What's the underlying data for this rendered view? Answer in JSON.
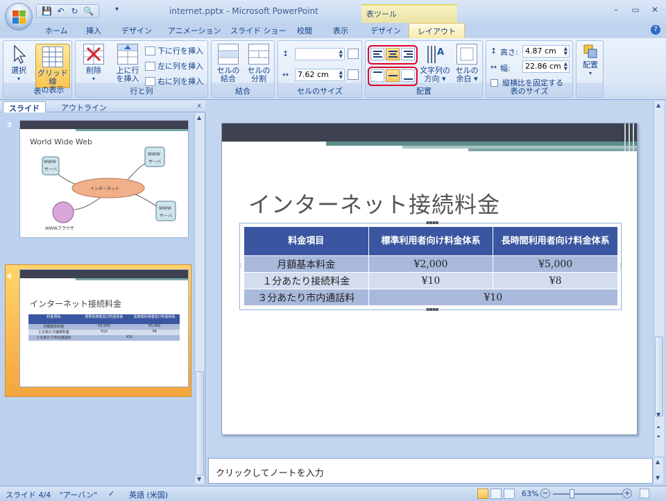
{
  "window": {
    "title": "internet.pptx - Microsoft PowerPoint",
    "contextual_label": "表ツール",
    "minimize": "–",
    "restore": "▭",
    "close": "✕"
  },
  "qat": {
    "save": "💾",
    "undo": "↶",
    "redo": "↻",
    "preview": "🔍",
    "more": "▾"
  },
  "tabs": [
    "ホーム",
    "挿入",
    "デザイン",
    "アニメーション",
    "スライド ショー",
    "校閲",
    "表示",
    "デザイン",
    "レイアウト"
  ],
  "active_tab": "レイアウト",
  "help": "?",
  "ribbon": {
    "groups": {
      "table": "表",
      "rows_cols": "行と列",
      "merge": "結合",
      "cell_size": "セルのサイズ",
      "alignment": "配置",
      "table_size": "表のサイズ",
      "arrange": ""
    },
    "select": {
      "line1": "選択",
      "line2": "▾"
    },
    "gridlines": {
      "line1": "グリッド線",
      "line2": "の表示"
    },
    "delete": {
      "line1": "削除",
      "line2": "▾"
    },
    "insert_above": {
      "line1": "上に行",
      "line2": "を挿入"
    },
    "insert_below": "下に行を挿入",
    "insert_left": "左に列を挿入",
    "insert_right": "右に列を挿入",
    "merge_cells": {
      "line1": "セルの",
      "line2": "結合"
    },
    "split_cells": {
      "line1": "セルの",
      "line2": "分割"
    },
    "height_value": "",
    "width_value": "7.62 cm",
    "text_direction": {
      "line1": "文字列の",
      "line2": "方向 ▾"
    },
    "cell_margins": {
      "line1": "セルの",
      "line2": "余白 ▾"
    },
    "table_height_label": "高さ:",
    "table_height": "4.87 cm",
    "table_width_label": "幅:",
    "table_width": "22.86 cm",
    "lock_aspect": "縦横比を固定する",
    "arrange": {
      "line1": "配置",
      "line2": "▾"
    }
  },
  "leftpane": {
    "tab_slides": "スライド",
    "tab_outline": "アウトライン",
    "close": "x",
    "slides": [
      {
        "num": "3",
        "title": "World Wide Web",
        "labels": [
          "WWW",
          "サーバ",
          "WWW",
          "サーバ",
          "WWW",
          "サーバ",
          "インターネット",
          "WWWブラウザ"
        ]
      },
      {
        "num": "4",
        "title": "インターネット接続料金",
        "mini_header": [
          "料金項目",
          "標準利用者向け料金体系",
          "長時間利用者向け料金体系"
        ],
        "mini_rows": [
          [
            "月額基本料金",
            "¥2,000",
            "¥5,000"
          ],
          [
            "１分あたり接続料金",
            "¥10",
            "¥8"
          ],
          [
            "３分あたり市内通話料",
            "¥10"
          ]
        ]
      }
    ]
  },
  "slide": {
    "title": "インターネット接続料金",
    "table": {
      "header": [
        "料金項目",
        "標準利用者向け料金体系",
        "長時間利用者向け料金体系"
      ],
      "rows": [
        [
          "月額基本料金",
          "¥2,000",
          "¥5,000"
        ],
        [
          "１分あたり接続料金",
          "¥10",
          "¥8"
        ],
        [
          "３分あたり市内通話料",
          "¥10"
        ]
      ]
    }
  },
  "notes_placeholder": "クリックしてノートを入力",
  "status": {
    "slide": "スライド 4/4",
    "theme": "\"アーバン\"",
    "language": "英語 (米国)",
    "zoom": "63%",
    "zoom_minus": "−",
    "zoom_plus": "+"
  },
  "colors": {
    "table_header": "#3b56a1",
    "row_dark": "#a9b9dc",
    "row_light": "#d4dcef",
    "highlight_red": "#e0002a",
    "slide_header": "#3e4150"
  }
}
